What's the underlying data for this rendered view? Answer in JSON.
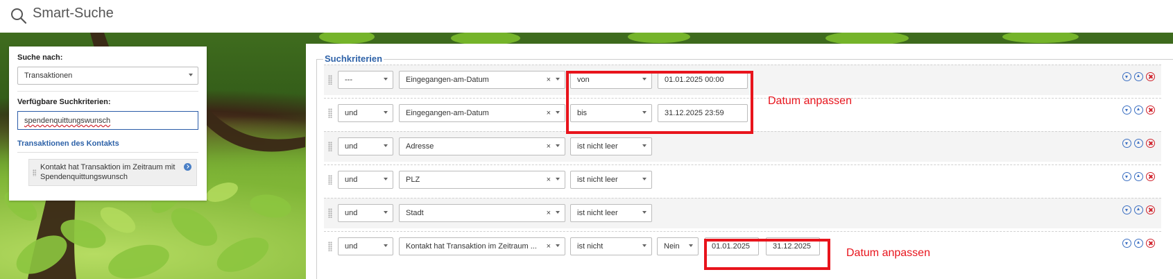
{
  "topbar": {
    "title": "Smart-Suche",
    "icon": "search-icon"
  },
  "left": {
    "search_for_label": "Suche nach:",
    "search_for_value": "Transaktionen",
    "available_label": "Verfügbare Suchkriterien:",
    "filter_value": "spendenquittungswunsch",
    "group_title": "Transaktionen des Kontakts",
    "card_text": "Kontakt hat Transaktion im Zeitraum mit Spendenquittungswunsch"
  },
  "criteria": {
    "legend": "Suchkriterien",
    "rows": [
      {
        "op": "---",
        "field": "Eingegangen-am-Datum",
        "cmp": "von",
        "value": "01.01.2025 00:00"
      },
      {
        "op": "und",
        "field": "Eingegangen-am-Datum",
        "cmp": "bis",
        "value": "31.12.2025 23:59"
      },
      {
        "op": "und",
        "field": "Adresse",
        "cmp": "ist nicht leer"
      },
      {
        "op": "und",
        "field": "PLZ",
        "cmp": "ist nicht leer"
      },
      {
        "op": "und",
        "field": "Stadt",
        "cmp": "ist nicht leer"
      },
      {
        "op": "und",
        "field": "Kontakt hat Transaktion im Zeitraum ...",
        "cmp": "ist nicht",
        "extra": "Nein",
        "date_from": "01.01.2025",
        "date_to": "31.12.2025"
      }
    ],
    "clear_glyph": "×"
  },
  "annotations": {
    "note1": "Datum anpassen",
    "note2": "Datum anpassen",
    "color": "#e8141c"
  }
}
